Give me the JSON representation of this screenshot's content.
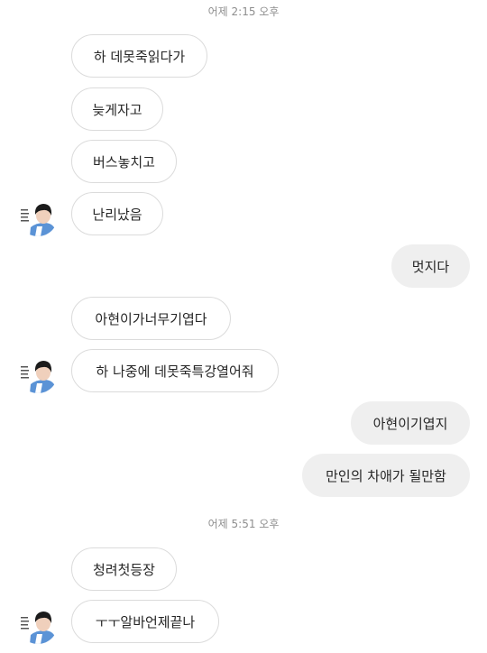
{
  "colors": {
    "background": "#ffffff",
    "incoming_bubble": "#ffffff",
    "incoming_border": "#dbdbdb",
    "outgoing_bubble": "#efefef",
    "text": "#262626",
    "timestamp": "#8e8e8e"
  },
  "timestamps": [
    "어제 2:15 오후",
    "어제 5:51 오후"
  ],
  "messages": [
    {
      "side": "incoming",
      "text": "하 데못죽읽다가"
    },
    {
      "side": "incoming",
      "text": "늦게자고"
    },
    {
      "side": "incoming",
      "text": "버스놓치고"
    },
    {
      "side": "incoming",
      "text": "난리났음"
    },
    {
      "side": "outgoing",
      "text": "멋지다"
    },
    {
      "side": "incoming",
      "text": "아현이가너무기엽다"
    },
    {
      "side": "incoming",
      "text": "하 나중에 데못죽특강열어줘"
    },
    {
      "side": "outgoing",
      "text": "아현이기엽지"
    },
    {
      "side": "outgoing",
      "text": "만인의 차애가 될만함"
    },
    {
      "side": "incoming",
      "text": "청려첫등장"
    },
    {
      "side": "incoming",
      "text": "ㅜㅜ알바언제끝나"
    }
  ],
  "avatar_icon": "user-avatar-photo"
}
